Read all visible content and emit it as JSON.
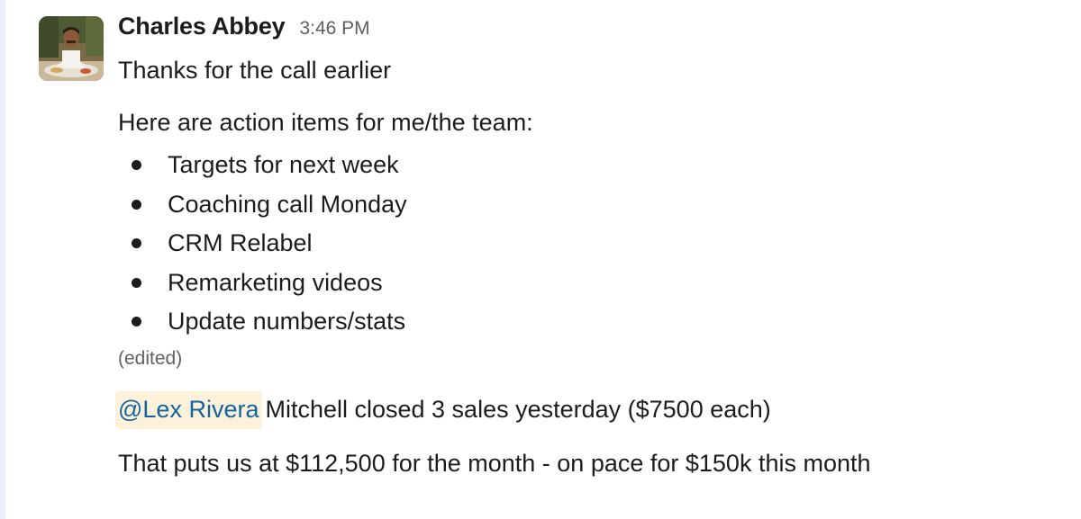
{
  "message": {
    "author": "Charles Abbey",
    "timestamp": "3:46 PM",
    "avatar_icon": "person-photo",
    "lines": {
      "greeting": "Thanks for the call earlier",
      "intro": "Here are action items for me/the team:"
    },
    "action_items": [
      "Targets for next week",
      "Coaching call Monday",
      "CRM Relabel",
      "Remarketing videos",
      "Update numbers/stats"
    ],
    "edited_label": "(edited)",
    "mention": {
      "user": "@Lex Rivera",
      "text": "Mitchell closed 3 sales yesterday ($7500 each)"
    },
    "closing": "That puts us at $112,500 for the month - on pace for $150k this month"
  },
  "colors": {
    "mention_bg": "#fdf1d9",
    "mention_text": "#1264a3",
    "muted_text": "#616061",
    "body_text": "#1d1c1d"
  }
}
